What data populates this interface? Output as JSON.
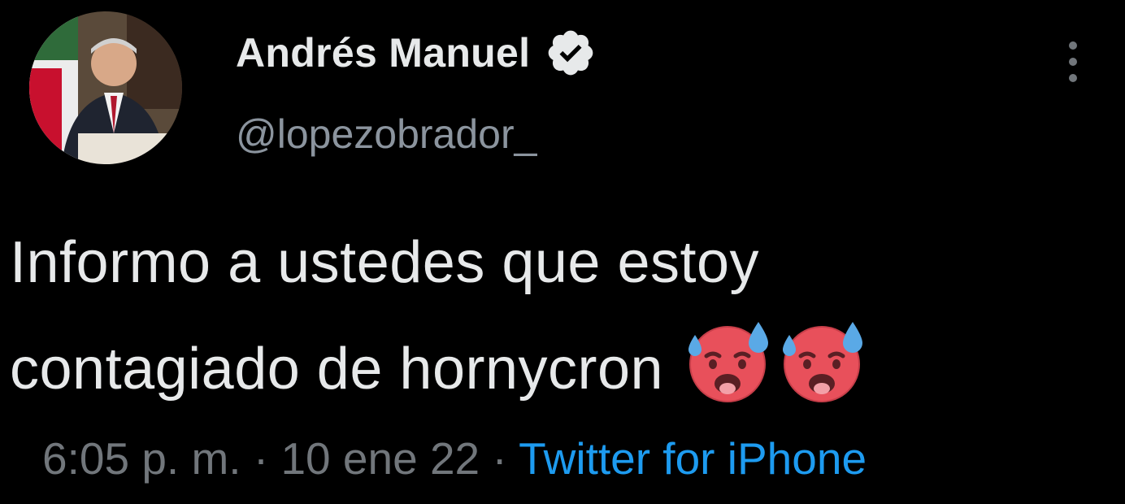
{
  "author": {
    "display_name": "Andrés Manuel",
    "handle": "@lopezobrador_",
    "verified_icon": "verified-badge-icon",
    "avatar": "profile-photo"
  },
  "tweet": {
    "line1": "Informo a ustedes que estoy",
    "line2": "contagiado de hornycron",
    "emojis": [
      "hot-face-sweat-emoji",
      "hot-face-sweat-emoji"
    ]
  },
  "meta": {
    "time": "6:05 p. m.",
    "separator": "·",
    "date": "10 ene 22",
    "source": "Twitter for iPhone"
  },
  "icons": {
    "more": "more-vertical-icon"
  },
  "colors": {
    "background": "#000000",
    "text": "#e7e9ea",
    "secondary": "#71767b",
    "link": "#1d9bf0"
  }
}
